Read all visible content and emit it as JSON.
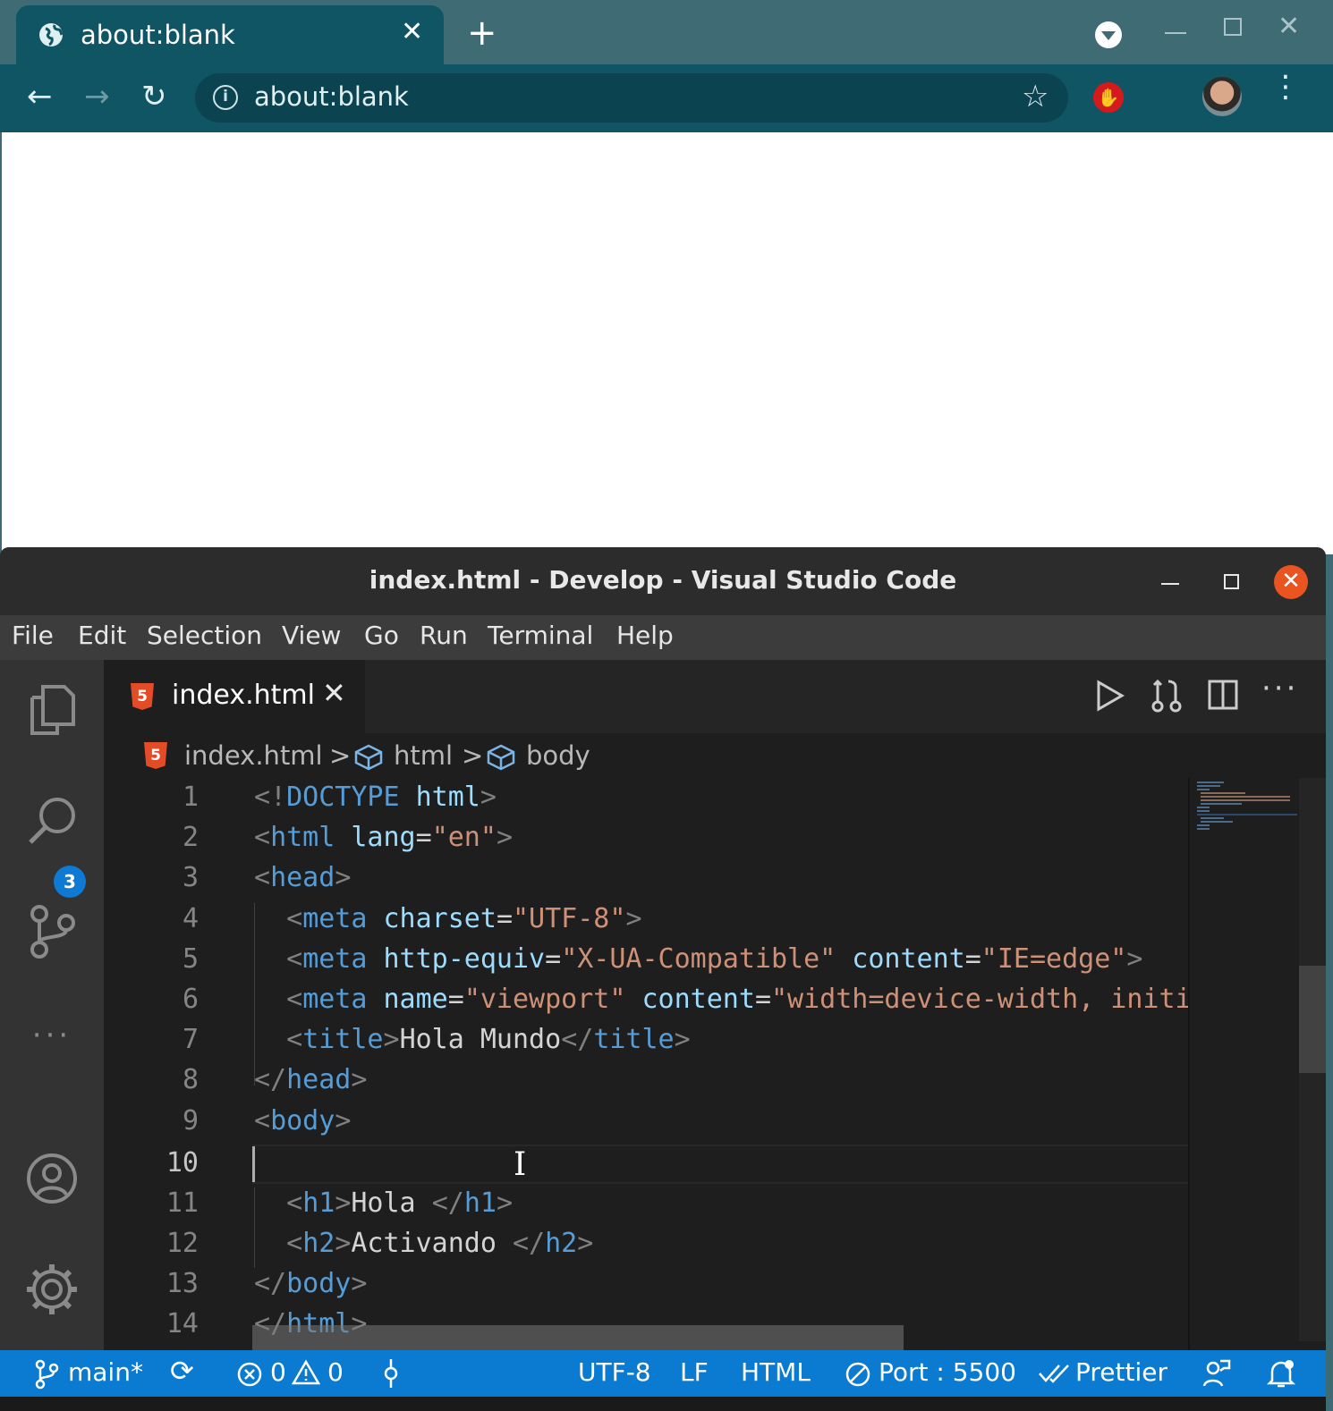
{
  "browser": {
    "tab_title": "about:blank",
    "new_tab_symbol": "+",
    "close_symbol": "✕",
    "url": "about:blank",
    "icons": [
      "globe-icon",
      "back-icon",
      "forward-icon",
      "reload-icon",
      "info-icon",
      "star-icon",
      "adblock-icon",
      "extensions-icon",
      "avatar",
      "menu-icon"
    ]
  },
  "vscode": {
    "window_title": "index.html - Develop - Visual Studio Code",
    "menu": [
      "File",
      "Edit",
      "Selection",
      "View",
      "Go",
      "Run",
      "Terminal",
      "Help"
    ],
    "scm_badge": "3",
    "tab": {
      "label": "index.html",
      "close": "✕"
    },
    "breadcrumb": {
      "file": "index.html",
      "sep": ">",
      "node1": "html",
      "node2": "body"
    },
    "line_numbers": [
      "1",
      "2",
      "3",
      "4",
      "5",
      "6",
      "7",
      "8",
      "9",
      "10",
      "11",
      "12",
      "13",
      "14"
    ],
    "current_line": "10",
    "status": {
      "branch": "main*",
      "errors": "0",
      "warnings": "0",
      "encoding": "UTF-8",
      "eol": "LF",
      "language": "HTML",
      "port": "Port : 5500",
      "formatter": "Prettier"
    },
    "accent": "#0b7ad1",
    "close_color": "#e95420"
  }
}
